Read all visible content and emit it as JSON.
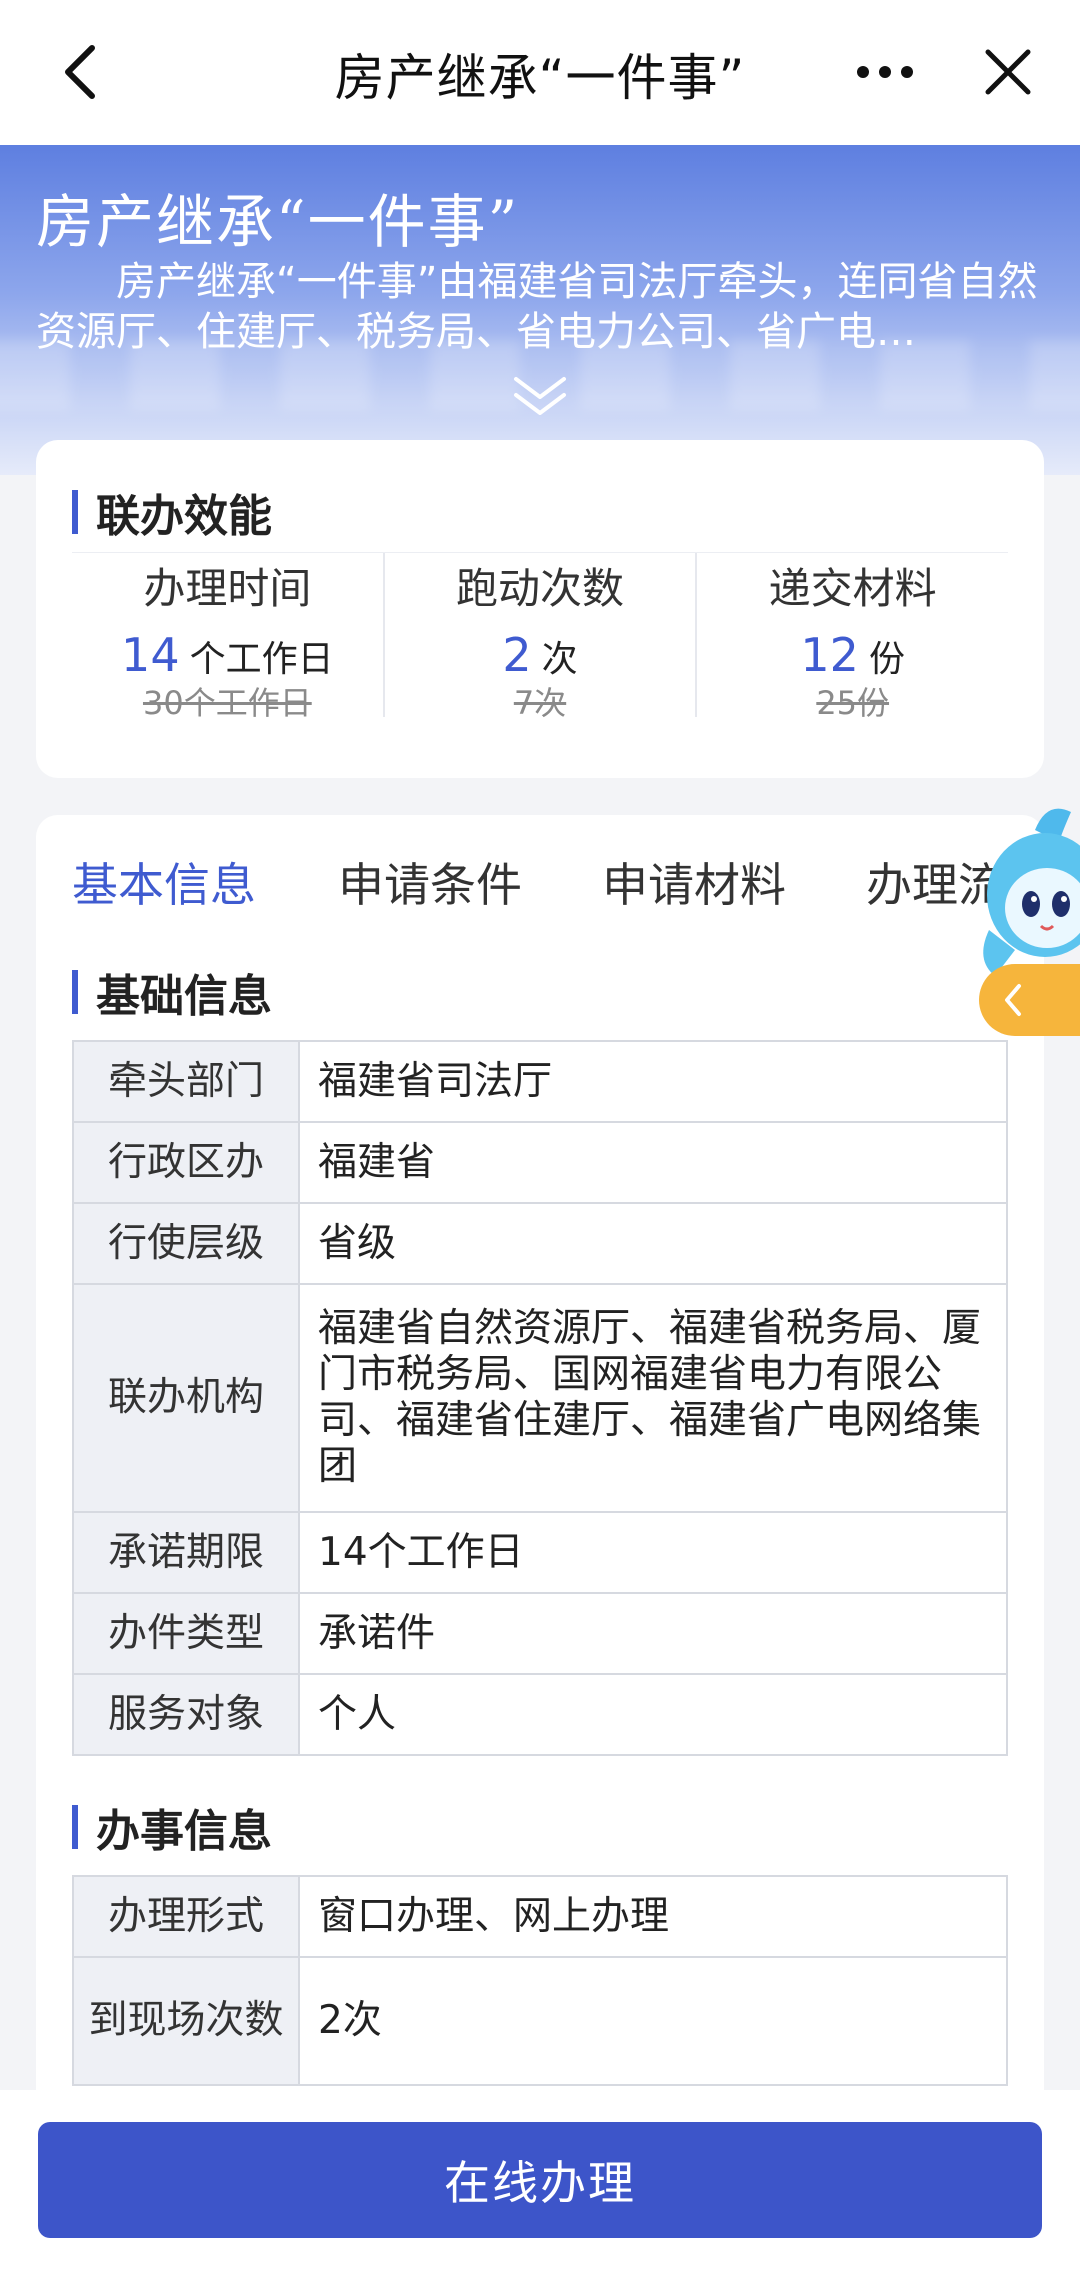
{
  "nav": {
    "title": "房产继承“一件事”"
  },
  "hero": {
    "title": "房产继承“一件事”",
    "description": "房产继承“一件事”由福建省司法厅牵头，连同省自然资源厅、住建厅、税务局、省电力公司、省广电…"
  },
  "efficiency": {
    "section_title": "联办效能",
    "items": [
      {
        "label": "办理时间",
        "value": "14",
        "unit": "个工作日",
        "old": "30个工作日"
      },
      {
        "label": "跑动次数",
        "value": "2",
        "unit": "次",
        "old": "7次"
      },
      {
        "label": "递交材料",
        "value": "12",
        "unit": "份",
        "old": "25份"
      }
    ]
  },
  "tabs": [
    "基本信息",
    "申请条件",
    "申请材料",
    "办理流程"
  ],
  "basic": {
    "section_title": "基础信息",
    "rows": [
      {
        "key": "牵头部门",
        "value": "福建省司法厅"
      },
      {
        "key": "行政区办",
        "value": "福建省"
      },
      {
        "key": "行使层级",
        "value": "省级"
      },
      {
        "key": "联办机构",
        "value": "福建省自然资源厅、福建省税务局、厦门市税务局、国网福建省电力有限公司、福建省住建厅、福建省广电网络集团"
      },
      {
        "key": "承诺期限",
        "value": "14个工作日"
      },
      {
        "key": "办件类型",
        "value": "承诺件"
      },
      {
        "key": "服务对象",
        "value": "个人"
      }
    ]
  },
  "handling": {
    "section_title": "办事信息",
    "rows": [
      {
        "key": "办理形式",
        "value": "窗口办理、网上办理"
      },
      {
        "key": "到现场次数",
        "value": "2次"
      }
    ]
  },
  "footer": {
    "button_label": "在线办理"
  },
  "colors": {
    "accent": "#3f5bd0",
    "button": "#3d55c9"
  }
}
